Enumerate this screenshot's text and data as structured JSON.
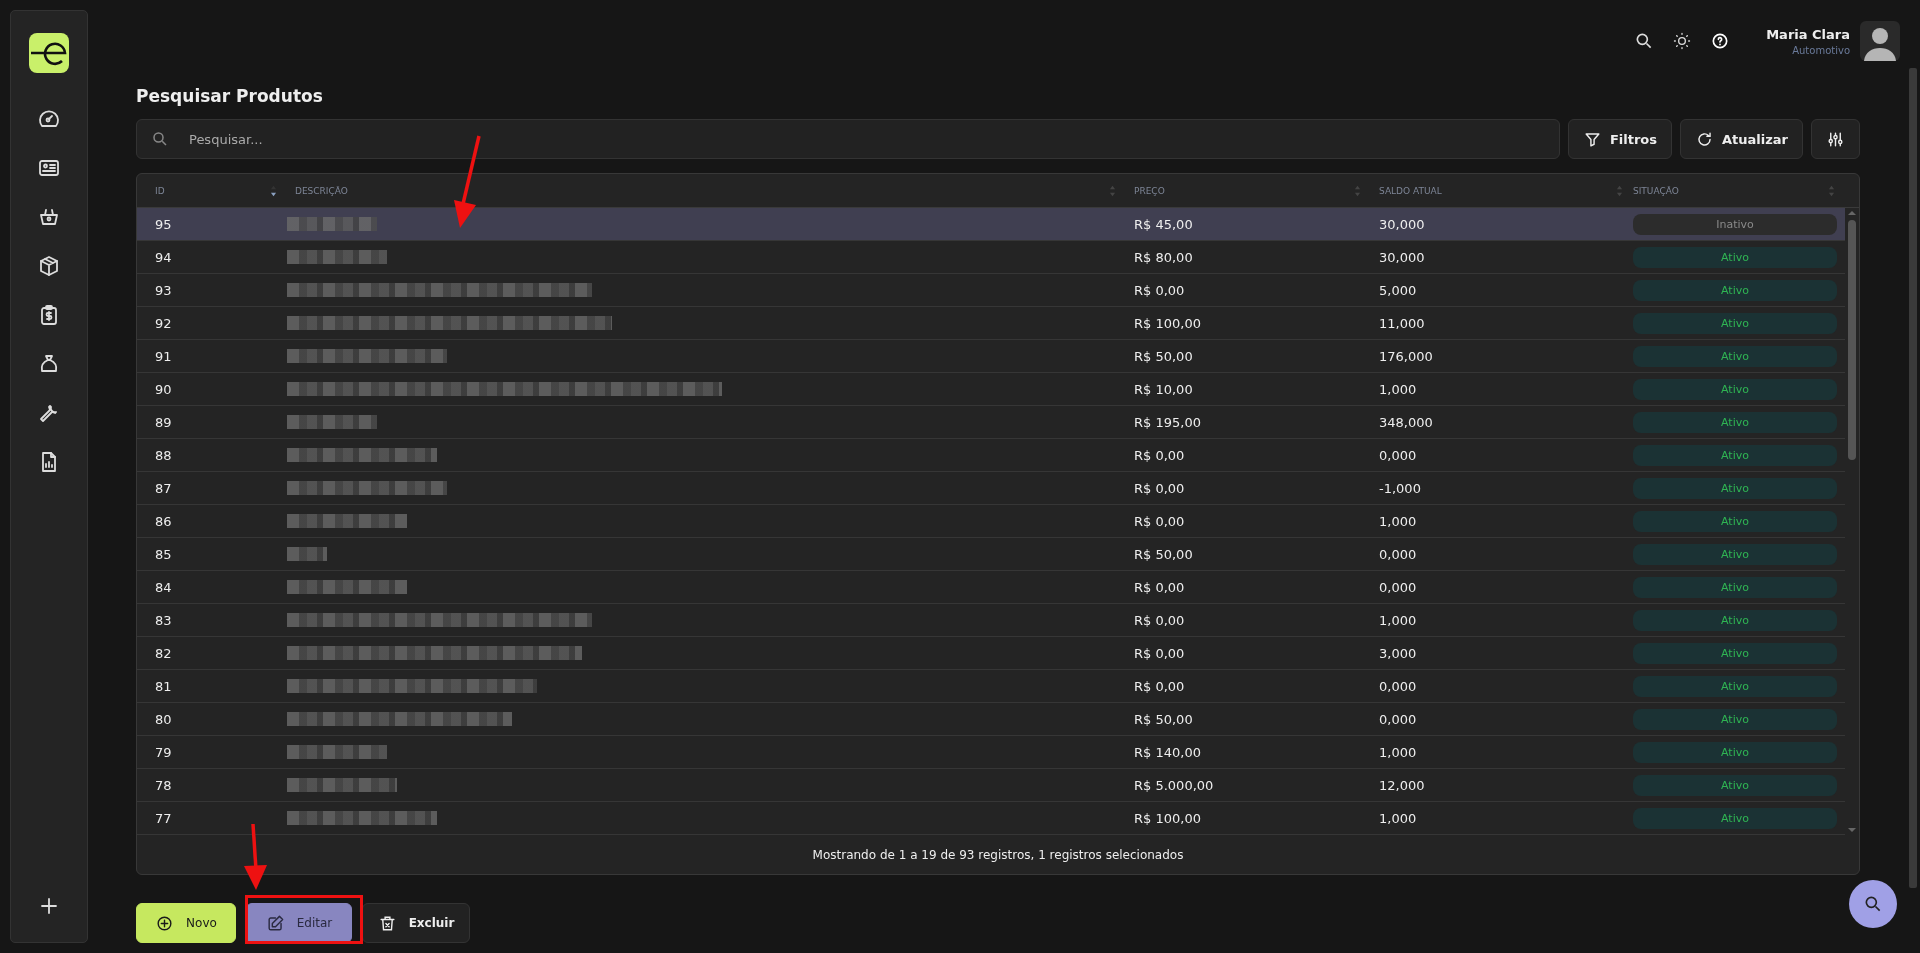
{
  "header": {
    "user_name": "Maria Clara",
    "user_company": "Automotivo"
  },
  "page_title": "Pesquisar Produtos",
  "search": {
    "placeholder": "Pesquisar..."
  },
  "toolbar": [
    {
      "kind": "filter",
      "label": "Filtros"
    },
    {
      "kind": "refresh",
      "label": "Atualizar"
    },
    {
      "kind": "columns"
    }
  ],
  "table": {
    "columns": [
      {
        "label": "ID",
        "sorted": true
      },
      {
        "label": "DESCRIÇÃO",
        "sorted": false
      },
      {
        "label": "PREÇO",
        "sorted": false
      },
      {
        "label": "SALDO ATUAL",
        "sorted": false
      },
      {
        "label": "SITUAÇÃO",
        "sorted": false
      }
    ],
    "rows": [
      {
        "id": "95",
        "price": "R$ 45,00",
        "balance": "30,000",
        "status": "Inativo",
        "active": false,
        "selected": true
      },
      {
        "id": "94",
        "price": "R$ 80,00",
        "balance": "30,000",
        "status": "Ativo",
        "active": true,
        "selected": false
      },
      {
        "id": "93",
        "price": "R$ 0,00",
        "balance": "5,000",
        "status": "Ativo",
        "active": true,
        "selected": false
      },
      {
        "id": "92",
        "price": "R$ 100,00",
        "balance": "11,000",
        "status": "Ativo",
        "active": true,
        "selected": false
      },
      {
        "id": "91",
        "price": "R$ 50,00",
        "balance": "176,000",
        "status": "Ativo",
        "active": true,
        "selected": false
      },
      {
        "id": "90",
        "price": "R$ 10,00",
        "balance": "1,000",
        "status": "Ativo",
        "active": true,
        "selected": false
      },
      {
        "id": "89",
        "price": "R$ 195,00",
        "balance": "348,000",
        "status": "Ativo",
        "active": true,
        "selected": false
      },
      {
        "id": "88",
        "price": "R$ 0,00",
        "balance": "0,000",
        "status": "Ativo",
        "active": true,
        "selected": false
      },
      {
        "id": "87",
        "price": "R$ 0,00",
        "balance": "-1,000",
        "status": "Ativo",
        "active": true,
        "selected": false
      },
      {
        "id": "86",
        "price": "R$ 0,00",
        "balance": "1,000",
        "status": "Ativo",
        "active": true,
        "selected": false
      },
      {
        "id": "85",
        "price": "R$ 50,00",
        "balance": "0,000",
        "status": "Ativo",
        "active": true,
        "selected": false
      },
      {
        "id": "84",
        "price": "R$ 0,00",
        "balance": "0,000",
        "status": "Ativo",
        "active": true,
        "selected": false
      },
      {
        "id": "83",
        "price": "R$ 0,00",
        "balance": "1,000",
        "status": "Ativo",
        "active": true,
        "selected": false
      },
      {
        "id": "82",
        "price": "R$ 0,00",
        "balance": "3,000",
        "status": "Ativo",
        "active": true,
        "selected": false
      },
      {
        "id": "81",
        "price": "R$ 0,00",
        "balance": "0,000",
        "status": "Ativo",
        "active": true,
        "selected": false
      },
      {
        "id": "80",
        "price": "R$ 50,00",
        "balance": "0,000",
        "status": "Ativo",
        "active": true,
        "selected": false
      },
      {
        "id": "79",
        "price": "R$ 140,00",
        "balance": "1,000",
        "status": "Ativo",
        "active": true,
        "selected": false
      },
      {
        "id": "78",
        "price": "R$ 5.000,00",
        "balance": "12,000",
        "status": "Ativo",
        "active": true,
        "selected": false
      },
      {
        "id": "77",
        "price": "R$ 100,00",
        "balance": "1,000",
        "status": "Ativo",
        "active": true,
        "selected": false
      }
    ]
  },
  "footer": "Mostrando de 1 a 19 de 93 registros, 1 registros selecionados",
  "actions": [
    {
      "kind": "new",
      "label": "Novo"
    },
    {
      "kind": "edit",
      "label": "Editar"
    },
    {
      "kind": "delete",
      "label": "Excluir"
    }
  ]
}
